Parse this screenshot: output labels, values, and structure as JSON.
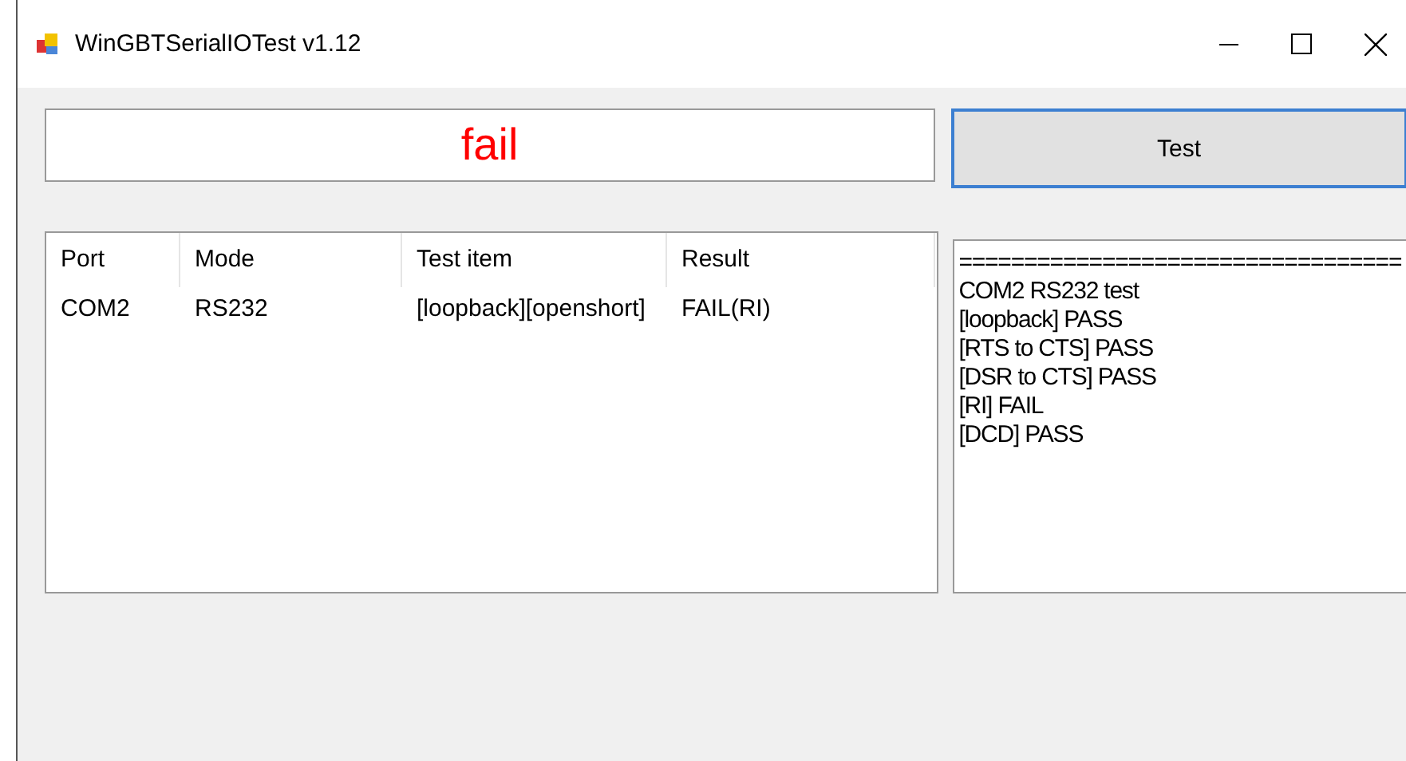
{
  "window": {
    "title": "WinGBTSerialIOTest v1.12"
  },
  "status": {
    "text": "fail",
    "kind": "fail"
  },
  "test_button": {
    "label": "Test"
  },
  "table": {
    "columns": [
      "Port",
      "Mode",
      "Test item",
      "Result"
    ],
    "rows": [
      {
        "cells": [
          "COM2",
          "RS232",
          "[loopback][openshort]",
          "FAIL(RI)"
        ]
      }
    ]
  },
  "log": {
    "lines": [
      "==================================",
      "COM2 RS232 test",
      "[loopback] PASS",
      "[RTS to CTS] PASS",
      "[DSR to CTS] PASS",
      "[RI] FAIL",
      "[DCD] PASS"
    ]
  }
}
